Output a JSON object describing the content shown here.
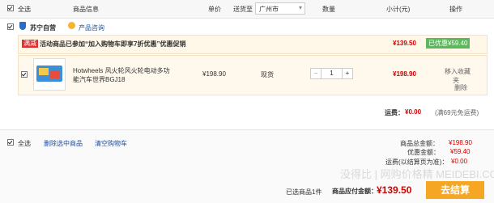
{
  "header": {
    "select_all": "全选",
    "product_info": "商品信息",
    "unit_price": "单价",
    "ship_to": "送货至",
    "city": "广州市",
    "quantity": "数量",
    "subtotal": "小计(元)",
    "operation": "操作"
  },
  "store": {
    "name": "苏宁自营",
    "consult": "产品咨询"
  },
  "promo": {
    "tag": "满减",
    "text": "活动商品已参加“加入购物车即享7折优惠”优惠促销",
    "amount": "¥139.50",
    "badge": "已优惠¥59.40"
  },
  "item": {
    "name_line1": "Hotwheels 风火轮风火轮电动多功",
    "name_line2": "能汽车世界BGJ18",
    "price": "¥198.90",
    "stock": "现货",
    "qty_minus": "−",
    "qty_value": "1",
    "qty_plus": "+",
    "subtotal": "¥198.90",
    "move_fav": "移入收藏",
    "move_fav2": "夹",
    "delete": "删除"
  },
  "shipping": {
    "label": "运费：",
    "amount": "¥0.00",
    "note": "(满69元免运费)"
  },
  "footer": {
    "select_all": "全选",
    "delete_selected": "删除选中商品",
    "clear_cart": "清空购物车",
    "total_label": "商品总金额：",
    "total_value": "¥198.90",
    "discount_label": "优惠金额：",
    "discount_value": "¥59.40",
    "shipping_label": "运费(以结算页为准)：",
    "shipping_value": "¥0.00",
    "selected_count": "已选商品1件",
    "payable_label": "商品应付金额：",
    "payable_value": "¥139.50",
    "checkout": "去结算"
  },
  "watermark": "没得比 | 网购价格精  MEIDEBI.COM",
  "colors": {
    "accent": "#d40000",
    "checkout": "#f5a623",
    "badge": "#5cb85c",
    "promo_tag": "#e0302f"
  }
}
